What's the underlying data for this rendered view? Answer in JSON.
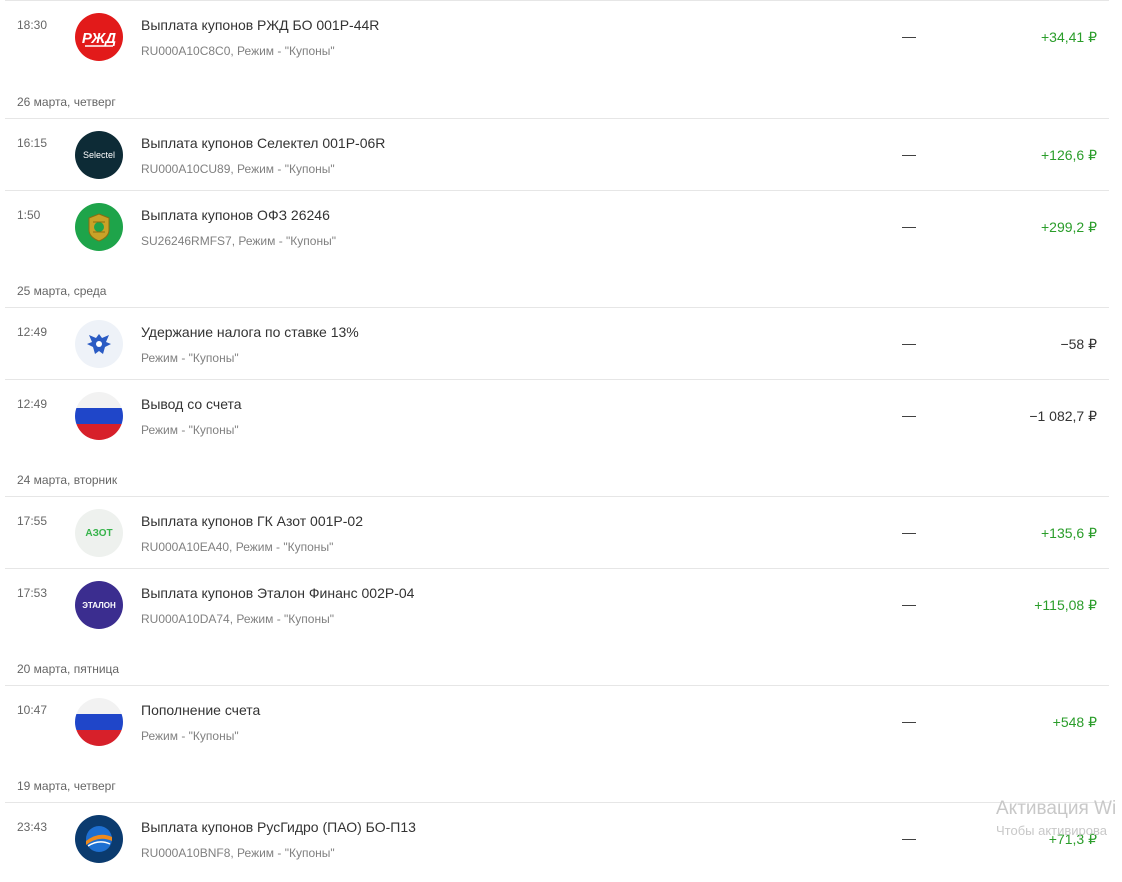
{
  "groups": [
    {
      "date": "",
      "rows": [
        {
          "time": "18:30",
          "logo": "rzd-logo",
          "title": "Выплата купонов РЖД БО 001Р-44R",
          "sub": "RU000A10C8C0, Режим - \"Купоны\"",
          "dash": "—",
          "amount": "+34,41 ₽",
          "sign": "pos"
        }
      ]
    },
    {
      "date": "26 марта, четверг",
      "rows": [
        {
          "time": "16:15",
          "logo": "selectel-logo",
          "logo_text": "Selectel",
          "title": "Выплата купонов Селектел 001Р-06R",
          "sub": "RU000A10CU89, Режим - \"Купоны\"",
          "dash": "—",
          "amount": "+126,6 ₽",
          "sign": "pos"
        },
        {
          "time": "1:50",
          "logo": "ofz-emblem-logo",
          "title": "Выплата купонов ОФЗ 26246",
          "sub": "SU26246RMFS7, Режим - \"Купоны\"",
          "dash": "—",
          "amount": "+299,2 ₽",
          "sign": "pos"
        }
      ]
    },
    {
      "date": "25 марта, среда",
      "rows": [
        {
          "time": "12:49",
          "logo": "eagle-emblem-logo",
          "title": "Удержание налога по ставке 13%",
          "sub": "Режим - \"Купоны\"",
          "dash": "—",
          "amount": "−58 ₽",
          "sign": "neg"
        },
        {
          "time": "12:49",
          "logo": "russian-flag-logo",
          "title": "Вывод со счета",
          "sub": "Режим - \"Купоны\"",
          "dash": "—",
          "amount": "−1 082,7 ₽",
          "sign": "neg"
        }
      ]
    },
    {
      "date": "24 марта, вторник",
      "rows": [
        {
          "time": "17:55",
          "logo": "azot-logo",
          "logo_text": "АЗОТ",
          "title": "Выплата купонов ГК Азот 001Р-02",
          "sub": "RU000A10EA40, Режим - \"Купоны\"",
          "dash": "—",
          "amount": "+135,6 ₽",
          "sign": "pos"
        },
        {
          "time": "17:53",
          "logo": "etalon-logo",
          "logo_text": "ЭТАЛОН",
          "title": "Выплата купонов Эталон Финанс 002Р-04",
          "sub": "RU000A10DA74, Режим - \"Купоны\"",
          "dash": "—",
          "amount": "+115,08 ₽",
          "sign": "pos"
        }
      ]
    },
    {
      "date": "20 марта, пятница",
      "rows": [
        {
          "time": "10:47",
          "logo": "russian-flag-logo",
          "title": "Пополнение счета",
          "sub": "Режим - \"Купоны\"",
          "dash": "—",
          "amount": "+548 ₽",
          "sign": "pos"
        }
      ]
    },
    {
      "date": "19 марта, четверг",
      "rows": [
        {
          "time": "23:43",
          "logo": "rushydro-logo",
          "title": "Выплата купонов РусГидро (ПАО) БО-П13",
          "sub": "RU000A10BNF8, Режим - \"Купоны\"",
          "dash": "—",
          "amount": "+71,3 ₽",
          "sign": "pos"
        }
      ]
    }
  ],
  "watermark": {
    "line1": "Активация Wi",
    "line2": "Чтобы активирова"
  },
  "colors": {
    "positive": "#2a9d2a",
    "negative": "#333333",
    "rzd": "#e21a1a",
    "selectel": "#0d2b36",
    "ofz": "#1ea44a",
    "etalon": "#3b2d8f",
    "rushydro": "#0b3b6f"
  }
}
